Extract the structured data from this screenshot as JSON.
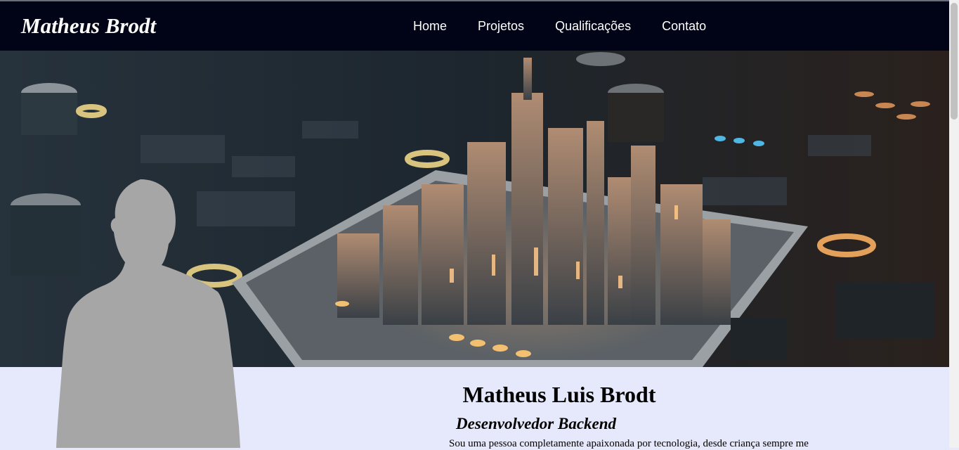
{
  "header": {
    "brand": "Matheus Brodt",
    "nav": [
      {
        "label": "Home"
      },
      {
        "label": "Projetos"
      },
      {
        "label": "Qualificações"
      },
      {
        "label": "Contato"
      }
    ]
  },
  "intro": {
    "name": "Matheus Luis Brodt",
    "role": "Desenvolvedor Backend",
    "bio": "Sou uma pessoa completamente apaixonada por tecnologia, desde criança sempre me"
  },
  "colors": {
    "header_bg": "#000416",
    "intro_bg": "#e6e8fb",
    "silhouette": "#a6a6a6"
  }
}
